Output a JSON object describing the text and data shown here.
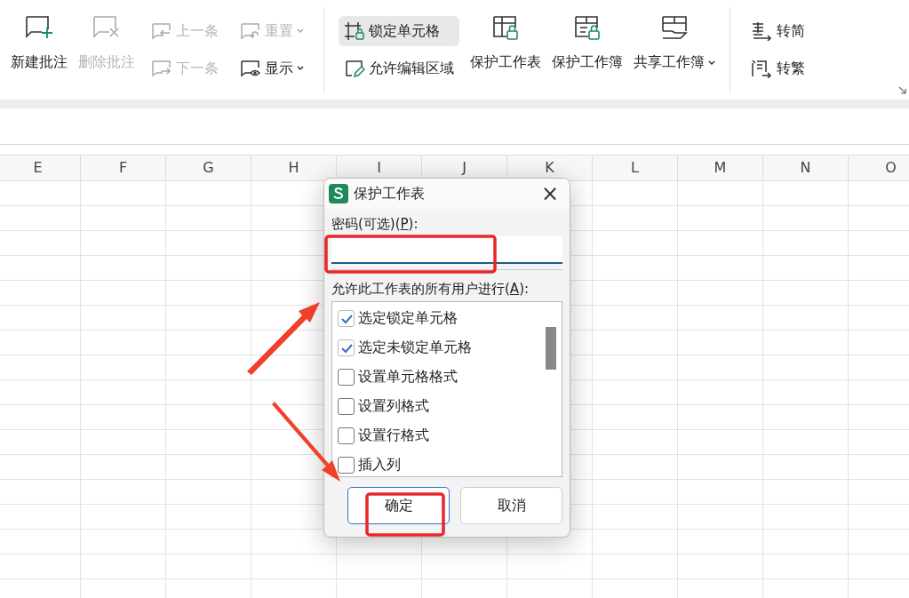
{
  "ribbon": {
    "groups": [
      {
        "kind": "large",
        "label": "新建批注",
        "disabled": false
      },
      {
        "kind": "large",
        "label": "删除批注",
        "disabled": true
      },
      {
        "kind": "stack",
        "items": [
          {
            "label": "上一条",
            "disabled": true,
            "dropdown": false
          },
          {
            "label": "下一条",
            "disabled": true,
            "dropdown": false
          }
        ]
      },
      {
        "kind": "stack",
        "items": [
          {
            "label": "重置",
            "disabled": true,
            "dropdown": true
          },
          {
            "label": "显示",
            "disabled": false,
            "dropdown": true
          }
        ]
      },
      {
        "kind": "separator"
      },
      {
        "kind": "stack",
        "items": [
          {
            "label": "锁定单元格",
            "disabled": false,
            "dropdown": false,
            "selected": true
          },
          {
            "label": "允许编辑区域",
            "disabled": false,
            "dropdown": false,
            "selected": false
          }
        ]
      },
      {
        "kind": "large",
        "label": "保护工作表",
        "disabled": false
      },
      {
        "kind": "large",
        "label": "保护工作簿",
        "disabled": false
      },
      {
        "kind": "large",
        "label": "共享工作簿",
        "disabled": false,
        "dropdown": true
      },
      {
        "kind": "separator"
      },
      {
        "kind": "stack",
        "items": [
          {
            "label": "转简",
            "disabled": false,
            "dropdown": false
          },
          {
            "label": "转繁",
            "disabled": false,
            "dropdown": false
          }
        ]
      }
    ]
  },
  "sheet": {
    "columns": [
      "E",
      "F",
      "G",
      "H",
      "I",
      "J",
      "K",
      "L",
      "M",
      "N",
      "O"
    ]
  },
  "dialog": {
    "title": "保护工作表",
    "close": "×",
    "password_label": {
      "before": "密码(可选)(",
      "key": "P",
      "after": "):"
    },
    "options_label": {
      "before": "允许此工作表的所有用户进行(",
      "key": "A",
      "after": "):"
    },
    "options": [
      {
        "label": "选定锁定单元格",
        "checked": true
      },
      {
        "label": "选定未锁定单元格",
        "checked": true
      },
      {
        "label": "设置单元格格式",
        "checked": false
      },
      {
        "label": "设置列格式",
        "checked": false
      },
      {
        "label": "设置行格式",
        "checked": false
      },
      {
        "label": "插入列",
        "checked": false
      }
    ],
    "buttons": [
      {
        "label": "确定",
        "default": true
      },
      {
        "label": "取消",
        "default": false
      }
    ]
  }
}
